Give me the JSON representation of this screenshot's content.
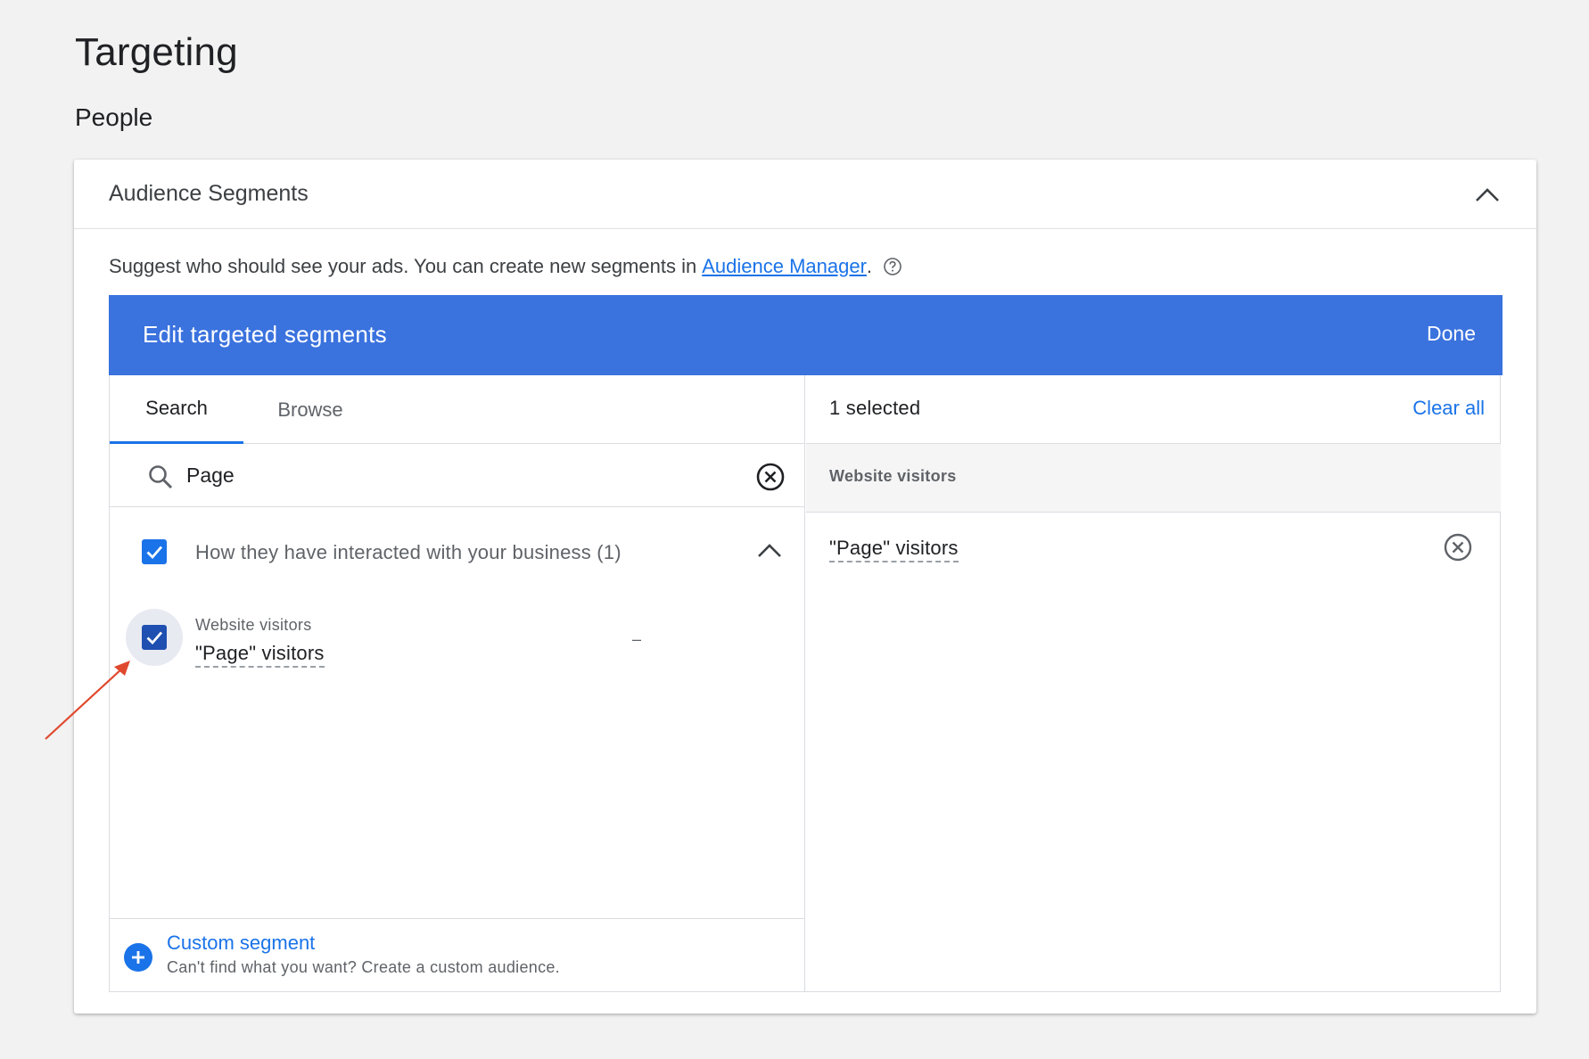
{
  "page": {
    "title": "Targeting",
    "section": "People"
  },
  "card": {
    "title": "Audience Segments",
    "description": "Suggest who should see your ads.  You can create new segments in",
    "link_text": "Audience Manager",
    "link_suffix": "."
  },
  "editor": {
    "title": "Edit targeted segments",
    "done_label": "Done",
    "header_color": "#3a72de"
  },
  "tabs": [
    {
      "label": "Search",
      "active": true
    },
    {
      "label": "Browse",
      "active": false
    }
  ],
  "search": {
    "value": "Page",
    "placeholder": ""
  },
  "results": {
    "category_label": "How they have interacted with your business (1)",
    "category_checked": true,
    "items": [
      {
        "category": "Website visitors",
        "name": "\"Page\" visitors",
        "checked": true,
        "trailing": "–"
      }
    ]
  },
  "custom_segment": {
    "title": "Custom segment",
    "subtitle": "Can't find what you want? Create a custom audience."
  },
  "selected": {
    "count_label": "1 selected",
    "clear_all_label": "Clear all",
    "group_label": "Website visitors",
    "items": [
      {
        "name": "\"Page\" visitors"
      }
    ]
  },
  "icons": {
    "collapse": "chevron-up-icon",
    "help": "help-circle-icon",
    "search": "search-icon",
    "clear": "cancel-circle-icon",
    "check": "check-icon",
    "add": "add-circle-icon"
  },
  "colors": {
    "accent": "#1a73e8",
    "annotation_arrow": "#e0482e"
  }
}
